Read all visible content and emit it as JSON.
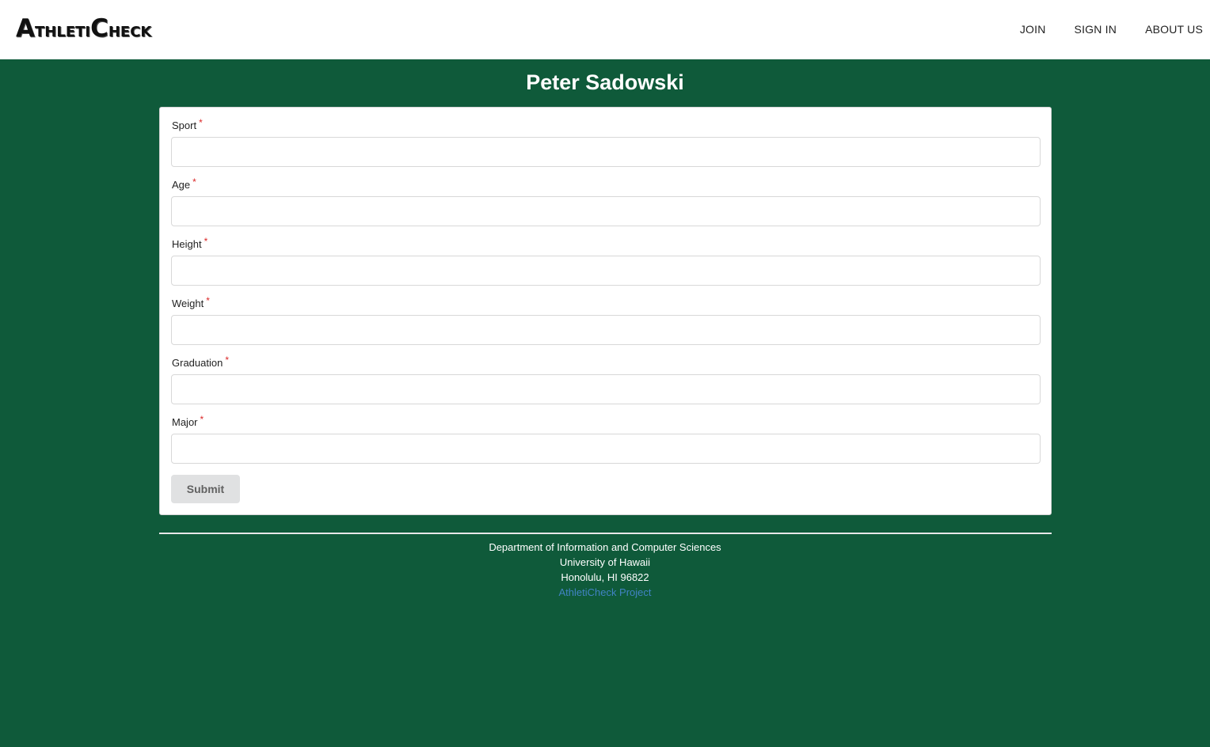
{
  "navbar": {
    "logo": {
      "a": "A",
      "thleti": "THLETI",
      "c": "C",
      "heck": "HECK"
    },
    "links": [
      "JOIN",
      "SIGN IN",
      "ABOUT US"
    ]
  },
  "page": {
    "title": "Peter Sadowski"
  },
  "form": {
    "required_marker": "*",
    "fields": [
      {
        "label": "Sport",
        "value": ""
      },
      {
        "label": "Age",
        "value": ""
      },
      {
        "label": "Height",
        "value": ""
      },
      {
        "label": "Weight",
        "value": ""
      },
      {
        "label": "Graduation",
        "value": ""
      },
      {
        "label": "Major",
        "value": ""
      }
    ],
    "submit_label": "Submit"
  },
  "footer": {
    "line1": "Department of Information and Computer Sciences",
    "line2": "University of Hawaii",
    "line3": "Honolulu, HI 96822",
    "link": "AthletiCheck Project"
  },
  "colors": {
    "background": "#0f5a3a",
    "required": "#db2828",
    "link": "#4183c4"
  }
}
